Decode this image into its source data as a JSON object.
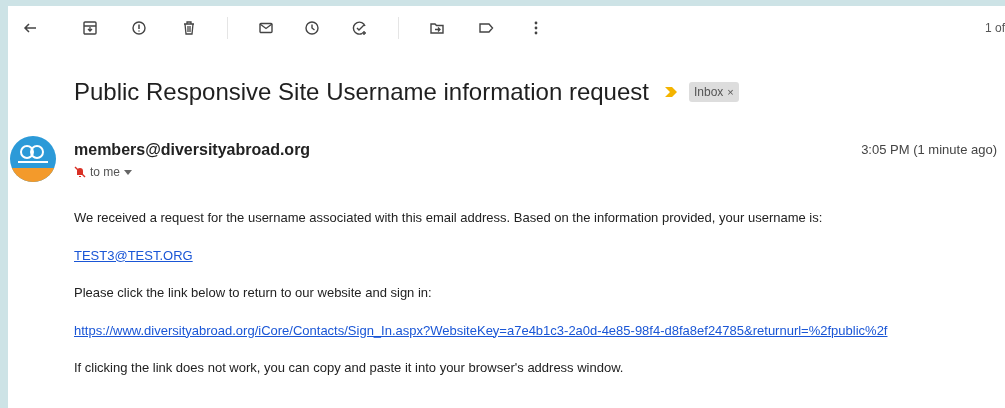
{
  "toolbar": {
    "counter": "1 of"
  },
  "subject": "Public Responsive Site Username information request",
  "label": {
    "text": "Inbox",
    "remove": "×"
  },
  "sender": {
    "email": "members@diversityabroad.org",
    "recipient": "to me",
    "time": "3:05 PM (1 minute ago)"
  },
  "body": [
    {
      "kind": "text",
      "text": "We received a request for the username associated with this email address. Based on the information provided, your username is:"
    },
    {
      "kind": "link",
      "text": "TEST3@TEST.ORG"
    },
    {
      "kind": "text",
      "text": "Please click the link below to return to our website and sign in:"
    },
    {
      "kind": "link",
      "text": "https://www.diversityabroad.org/iCore/Contacts/Sign_In.aspx?WebsiteKey=a7e4b1c3-2a0d-4e85-98f4-d8fa8ef24785&returnurl=%2fpublic%2f"
    },
    {
      "kind": "text",
      "text": "If clicking the link does not work, you can copy and paste it into your browser's address window."
    }
  ]
}
